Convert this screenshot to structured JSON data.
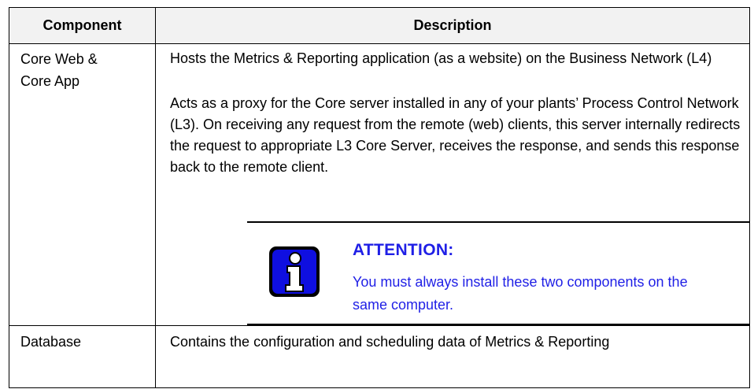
{
  "table": {
    "headers": {
      "component": "Component",
      "description": "Description"
    },
    "rows": [
      {
        "component_line1": "Core Web &",
        "component_line2": "Core App",
        "description_paragraphs": [
          "Hosts the Metrics & Reporting application (as a website) on the Business Network (L4)",
          "Acts as a proxy for the Core server installed in any of your plants’ Process Control Network (L3). On receiving any request from the remote (web) clients, this server internally redirects the request to appropriate L3 Core Server, receives the response, and sends this response back to the remote client."
        ],
        "attention": {
          "icon": "info-icon",
          "title": "ATTENTION:",
          "body": "You must always install these two components on the same computer."
        }
      },
      {
        "component": "Database",
        "description": "Contains the configuration and scheduling data of Metrics & Reporting"
      }
    ]
  },
  "colors": {
    "attention_text": "#1f1fe6",
    "icon_blue": "#0f0fe0",
    "header_background": "#f2f2f2",
    "border": "#000000"
  }
}
